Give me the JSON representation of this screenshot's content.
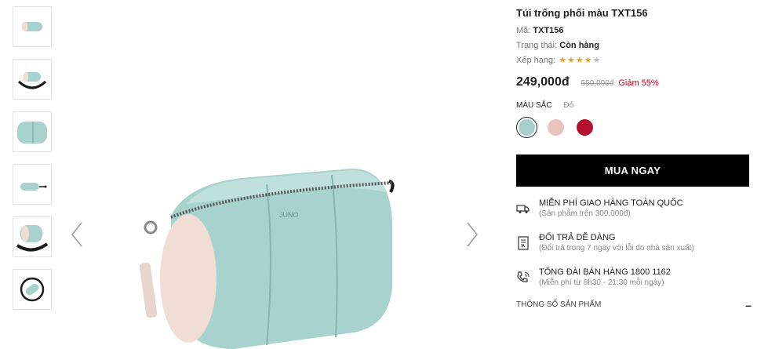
{
  "product": {
    "title": "Túi trống phối màu TXT156",
    "code_label": "Mã:",
    "code": "TXT156",
    "status_label": "Trạng thái:",
    "status": "Còn hàng",
    "rating_label": "Xếp hạng:",
    "rating": 4,
    "rating_max": 5,
    "price": "249,000đ",
    "old_price": "550,000đ",
    "discount": "Giảm 55%"
  },
  "colors": {
    "label": "MÀU SẮC",
    "current": "Đỏ",
    "options": [
      {
        "name": "mint",
        "hex": "#a7cfcd"
      },
      {
        "name": "pink",
        "hex": "#e8c4bd"
      },
      {
        "name": "red",
        "hex": "#b5112e"
      }
    ]
  },
  "buy_button": "MUA NGAY",
  "features": [
    {
      "icon": "truck-icon",
      "title": "MIỄN PHÍ GIAO HÀNG TOÀN QUỐC",
      "subtitle": "(Sản phẩm trên 300,000đ)"
    },
    {
      "icon": "return-document-icon",
      "title": "ĐỔI TRẢ DỄ DÀNG",
      "subtitle": "(Đổi trả trong 7 ngày với lỗi do nhà sản xuất)"
    },
    {
      "icon": "phone-support-icon",
      "title": "TỔNG ĐÀI BÁN HÀNG 1800 1162",
      "subtitle": "(Miễn phí từ 8h30 - 21:30 mỗi ngày)"
    }
  ],
  "specs": {
    "label": "THÔNG SỐ SẢN PHẨM",
    "toggle": "–"
  },
  "gallery": {
    "thumbnail_count": 6,
    "brand_mark": "JUNO",
    "colors": {
      "bag": "#a8d2cd",
      "bag_shadow": "#86b3ae",
      "cream": "#f0ddd3",
      "strap": "#1a1a1a"
    }
  }
}
